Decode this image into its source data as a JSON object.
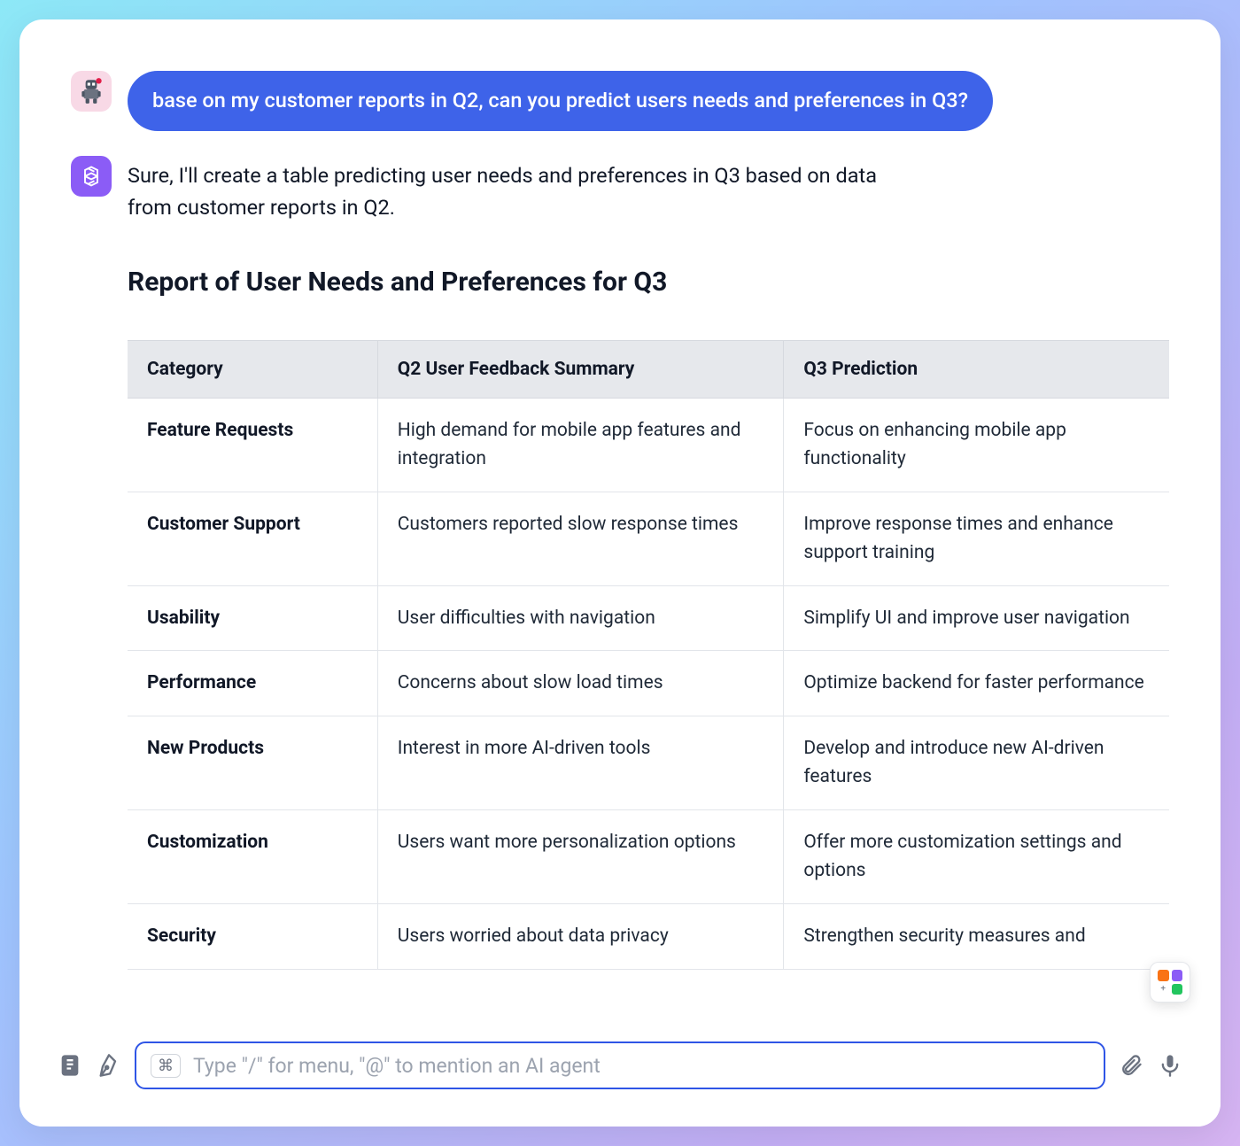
{
  "chat": {
    "user_message": "base on my customer reports in Q2, can you predict users needs and preferences in Q3?",
    "ai_message": "Sure, I'll create a table predicting user needs and preferences in Q3 based on data from customer reports in Q2."
  },
  "report": {
    "title": "Report of User Needs and Preferences for Q3",
    "columns": [
      "Category",
      "Q2 User Feedback Summary",
      "Q3 Prediction"
    ],
    "rows": [
      {
        "category": "Feature Requests",
        "q2": "High demand for mobile app features and integration",
        "q3": "Focus on enhancing mobile app functionality"
      },
      {
        "category": "Customer Support",
        "q2": "Customers reported slow response times",
        "q3": "Improve response times and enhance support training"
      },
      {
        "category": "Usability",
        "q2": "User difficulties with navigation",
        "q3": "Simplify UI and improve user navigation"
      },
      {
        "category": "Performance",
        "q2": "Concerns about slow load times",
        "q3": "Optimize backend for faster performance"
      },
      {
        "category": "New Products",
        "q2": "Interest in more AI-driven tools",
        "q3": "Develop and introduce new AI-driven features"
      },
      {
        "category": "Customization",
        "q2": "Users want more personalization options",
        "q3": "Offer more customization settings and options"
      },
      {
        "category": "Security",
        "q2": "Users worried about data privacy",
        "q3": "Strengthen security measures and"
      }
    ]
  },
  "input": {
    "cmd_key": "⌘",
    "placeholder": "Type \"/\" for menu, \"@\" to mention an AI agent"
  }
}
